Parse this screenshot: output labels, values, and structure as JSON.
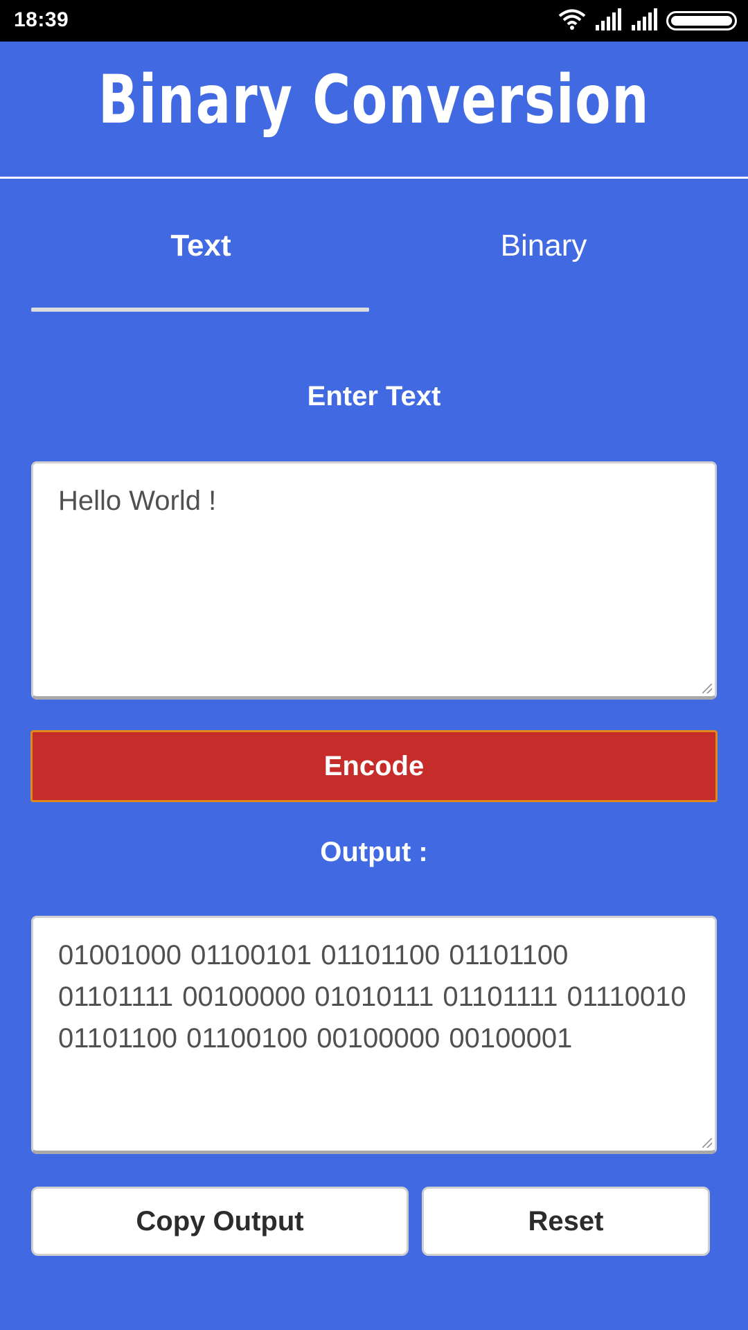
{
  "status_bar": {
    "time": "18:39",
    "icons": [
      "wifi-icon",
      "signal-icon",
      "signal-icon",
      "battery-icon"
    ]
  },
  "header": {
    "title": "Binary Conversion"
  },
  "tabs": [
    {
      "label": "Text",
      "selected": true
    },
    {
      "label": "Binary",
      "selected": false
    }
  ],
  "input_section": {
    "label": "Enter Text",
    "value": "Hello World !"
  },
  "encode_button": {
    "label": "Encode"
  },
  "output_section": {
    "label": "Output :",
    "value": "01001000 01100101 01101100 01101100 01101111 00100000 01010111 01101111 01110010 01101100 01100100 00100000 00100001"
  },
  "actions": {
    "copy_label": "Copy Output",
    "reset_label": "Reset"
  },
  "colors": {
    "background": "#4169e1",
    "encode_button": "#c62d2a",
    "encode_border": "#e08a1c",
    "text_on_white": "#505050"
  }
}
